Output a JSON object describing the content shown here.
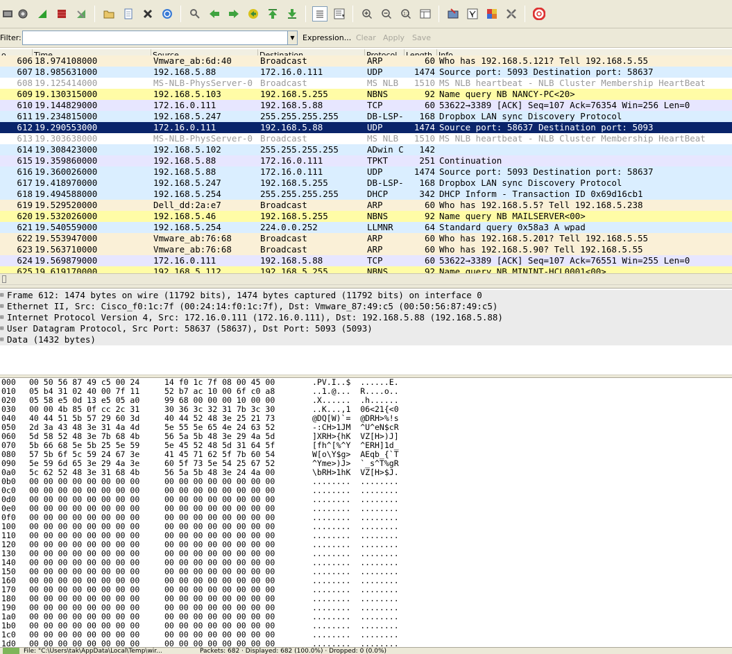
{
  "toolbar": {
    "icons": [
      "interface-list-icon",
      "capture-options-icon",
      "start-capture-icon",
      "stop-capture-icon",
      "restart-capture-icon",
      "open-file-icon",
      "save-file-icon",
      "close-file-icon",
      "reload-file-icon",
      "find-packet-icon",
      "go-back-icon",
      "go-forward-icon",
      "go-to-packet-icon",
      "go-first-icon",
      "go-last-icon",
      "colorize-icon",
      "auto-scroll-icon",
      "zoom-in-icon",
      "zoom-out-icon",
      "normal-size-icon",
      "resize-columns-icon",
      "capture-filters-icon",
      "display-filters-icon",
      "coloring-rules-icon",
      "preferences-icon",
      "help-icon"
    ]
  },
  "filter": {
    "label": "Filter:",
    "value": "",
    "expression": "Expression...",
    "clear": "Clear",
    "apply": "Apply",
    "save": "Save"
  },
  "packet_list": {
    "columns": [
      "o.",
      "Time",
      "Source",
      "Destination",
      "Protocol",
      "Length",
      "Info"
    ],
    "rows": [
      {
        "no": "606",
        "time": "18.974108000",
        "src": "Vmware_ab:6d:40",
        "dst": "Broadcast",
        "proto": "ARP",
        "len": "60",
        "info": "Who has 192.168.5.121?  Tell 192.168.5.55",
        "style": "arp"
      },
      {
        "no": "607",
        "time": "18.985631000",
        "src": "192.168.5.88",
        "dst": "172.16.0.111",
        "proto": "UDP",
        "len": "1474",
        "info": "Source port: 5093  Destination port: 58637",
        "style": "udp"
      },
      {
        "no": "608",
        "time": "19.125414000",
        "src": "MS-NLB-PhysServer-0",
        "dst": "Broadcast",
        "proto": "MS NLB",
        "len": "1510",
        "info": "MS NLB heartbeat - NLB Cluster Membership HeartBeat",
        "style": "nlb"
      },
      {
        "no": "609",
        "time": "19.130315000",
        "src": "192.168.5.103",
        "dst": "192.168.5.255",
        "proto": "NBNS",
        "len": "92",
        "info": "Name query NB NANCY-PC<20>",
        "style": "nbns"
      },
      {
        "no": "610",
        "time": "19.144829000",
        "src": "172.16.0.111",
        "dst": "192.168.5.88",
        "proto": "TCP",
        "len": "60",
        "info": "53622→3389 [ACK] Seq=107 Ack=76354 Win=256 Len=0",
        "style": "tcp"
      },
      {
        "no": "611",
        "time": "19.234815000",
        "src": "192.168.5.247",
        "dst": "255.255.255.255",
        "proto": "DB-LSP-",
        "len": "168",
        "info": "Dropbox LAN sync Discovery Protocol",
        "style": "udp"
      },
      {
        "no": "612",
        "time": "19.290553000",
        "src": "172.16.0.111",
        "dst": "192.168.5.88",
        "proto": "UDP",
        "len": "1474",
        "info": "Source port: 58637  Destination port: 5093",
        "style": "selected"
      },
      {
        "no": "613",
        "time": "19.303638000",
        "src": "MS-NLB-PhysServer-0",
        "dst": "Broadcast",
        "proto": "MS NLB",
        "len": "1510",
        "info": "MS NLB heartbeat - NLB Cluster Membership HeartBeat",
        "style": "nlb"
      },
      {
        "no": "614",
        "time": "19.308423000",
        "src": "192.168.5.102",
        "dst": "255.255.255.255",
        "proto": "ADwin C",
        "len": "142",
        "info": "",
        "style": "udp"
      },
      {
        "no": "615",
        "time": "19.359860000",
        "src": "192.168.5.88",
        "dst": "172.16.0.111",
        "proto": "TPKT",
        "len": "251",
        "info": "Continuation",
        "style": "tcp"
      },
      {
        "no": "616",
        "time": "19.360026000",
        "src": "192.168.5.88",
        "dst": "172.16.0.111",
        "proto": "UDP",
        "len": "1474",
        "info": "Source port: 5093  Destination port: 58637",
        "style": "udp"
      },
      {
        "no": "617",
        "time": "19.418970000",
        "src": "192.168.5.247",
        "dst": "192.168.5.255",
        "proto": "DB-LSP-",
        "len": "168",
        "info": "Dropbox LAN sync Discovery Protocol",
        "style": "udp"
      },
      {
        "no": "618",
        "time": "19.494588000",
        "src": "192.168.5.254",
        "dst": "255.255.255.255",
        "proto": "DHCP",
        "len": "342",
        "info": "DHCP Inform   - Transaction ID 0x69d16cb1",
        "style": "udp"
      },
      {
        "no": "619",
        "time": "19.529520000",
        "src": "Dell_dd:2a:e7",
        "dst": "Broadcast",
        "proto": "ARP",
        "len": "60",
        "info": "Who has 192.168.5.5?  Tell 192.168.5.238",
        "style": "arp"
      },
      {
        "no": "620",
        "time": "19.532026000",
        "src": "192.168.5.46",
        "dst": "192.168.5.255",
        "proto": "NBNS",
        "len": "92",
        "info": "Name query NB MAILSERVER<00>",
        "style": "nbns"
      },
      {
        "no": "621",
        "time": "19.540559000",
        "src": "192.168.5.254",
        "dst": "224.0.0.252",
        "proto": "LLMNR",
        "len": "64",
        "info": "Standard query 0x58a3  A wpad",
        "style": "udp"
      },
      {
        "no": "622",
        "time": "19.553947000",
        "src": "Vmware_ab:76:68",
        "dst": "Broadcast",
        "proto": "ARP",
        "len": "60",
        "info": "Who has 192.168.5.201?  Tell 192.168.5.55",
        "style": "arp"
      },
      {
        "no": "623",
        "time": "19.563710000",
        "src": "Vmware_ab:76:68",
        "dst": "Broadcast",
        "proto": "ARP",
        "len": "60",
        "info": "Who has 192.168.5.90?  Tell 192.168.5.55",
        "style": "arp"
      },
      {
        "no": "624",
        "time": "19.569879000",
        "src": "172.16.0.111",
        "dst": "192.168.5.88",
        "proto": "TCP",
        "len": "60",
        "info": "53622→3389 [ACK] Seq=107 Ack=76551 Win=255 Len=0",
        "style": "tcp"
      },
      {
        "no": "625",
        "time": "19.619170000",
        "src": "192.168.5.112",
        "dst": "192.168.5.255",
        "proto": "NBNS",
        "len": "92",
        "info": "Name query NB MININT-HCL0001<00>",
        "style": "nbns"
      }
    ]
  },
  "details": [
    "Frame 612: 1474 bytes on wire (11792 bits), 1474 bytes captured (11792 bits) on interface 0",
    "Ethernet II, Src: Cisco_f0:1c:7f (00:24:14:f0:1c:7f), Dst: Vmware_87:49:c5 (00:50:56:87:49:c5)",
    "Internet Protocol Version 4, Src: 172.16.0.111 (172.16.0.111), Dst: 192.168.5.88 (192.168.5.88)",
    "User Datagram Protocol, Src Port: 58637 (58637), Dst Port: 5093 (5093)",
    "Data (1432 bytes)"
  ],
  "bytes": [
    {
      "off": "000",
      "hex1": "00 50 56 87 49 c5 00 24",
      "hex2": "14 f0 1c 7f 08 00 45 00",
      "ascii": ".PV.I..$  ......E."
    },
    {
      "off": "010",
      "hex1": "05 b4 31 02 40 00 7f 11",
      "hex2": "52 b7 ac 10 00 6f c0 a8",
      "ascii": "..1.@...  R....o.."
    },
    {
      "off": "020",
      "hex1": "05 58 e5 0d 13 e5 05 a0",
      "hex2": "99 68 00 00 00 10 00 00",
      "ascii": ".X......  .h......"
    },
    {
      "off": "030",
      "hex1": "00 00 4b 85 0f cc 2c 31",
      "hex2": "30 36 3c 32 31 7b 3c 30",
      "ascii": "..K...,1  06<21{<0"
    },
    {
      "off": "040",
      "hex1": "40 44 51 5b 57 29 60 3d",
      "hex2": "40 44 52 48 3e 25 21 73",
      "ascii": "@DQ[W)`=  @DRH>%!s"
    },
    {
      "off": "050",
      "hex1": "2d 3a 43 48 3e 31 4a 4d",
      "hex2": "5e 55 5e 65 4e 24 63 52",
      "ascii": "-:CH>1JM  ^U^eN$cR"
    },
    {
      "off": "060",
      "hex1": "5d 58 52 48 3e 7b 68 4b",
      "hex2": "56 5a 5b 48 3e 29 4a 5d",
      "ascii": "]XRH>{hK  VZ[H>)J]"
    },
    {
      "off": "070",
      "hex1": "5b 66 68 5e 5b 25 5e 59",
      "hex2": "5e 45 52 48 5d 31 64 5f",
      "ascii": "[fh^[%^Y  ^ERH]1d_"
    },
    {
      "off": "080",
      "hex1": "57 5b 6f 5c 59 24 67 3e",
      "hex2": "41 45 71 62 5f 7b 60 54",
      "ascii": "W[o\\Y$g>  AEqb_{`T"
    },
    {
      "off": "090",
      "hex1": "5e 59 6d 65 3e 29 4a 3e",
      "hex2": "60 5f 73 5e 54 25 67 52",
      "ascii": "^Yme>)J>  `_s^T%gR"
    },
    {
      "off": "0a0",
      "hex1": "5c 62 52 48 3e 31 68 4b",
      "hex2": "56 5a 5b 48 3e 24 4a 00",
      "ascii": "\\bRH>1hK  VZ[H>$J."
    },
    {
      "off": "0b0",
      "hex1": "00 00 00 00 00 00 00 00",
      "hex2": "00 00 00 00 00 00 00 00",
      "ascii": "........  ........"
    },
    {
      "off": "0c0",
      "hex1": "00 00 00 00 00 00 00 00",
      "hex2": "00 00 00 00 00 00 00 00",
      "ascii": "........  ........"
    },
    {
      "off": "0d0",
      "hex1": "00 00 00 00 00 00 00 00",
      "hex2": "00 00 00 00 00 00 00 00",
      "ascii": "........  ........"
    },
    {
      "off": "0e0",
      "hex1": "00 00 00 00 00 00 00 00",
      "hex2": "00 00 00 00 00 00 00 00",
      "ascii": "........  ........"
    },
    {
      "off": "0f0",
      "hex1": "00 00 00 00 00 00 00 00",
      "hex2": "00 00 00 00 00 00 00 00",
      "ascii": "........  ........"
    },
    {
      "off": "100",
      "hex1": "00 00 00 00 00 00 00 00",
      "hex2": "00 00 00 00 00 00 00 00",
      "ascii": "........  ........"
    },
    {
      "off": "110",
      "hex1": "00 00 00 00 00 00 00 00",
      "hex2": "00 00 00 00 00 00 00 00",
      "ascii": "........  ........"
    },
    {
      "off": "120",
      "hex1": "00 00 00 00 00 00 00 00",
      "hex2": "00 00 00 00 00 00 00 00",
      "ascii": "........  ........"
    },
    {
      "off": "130",
      "hex1": "00 00 00 00 00 00 00 00",
      "hex2": "00 00 00 00 00 00 00 00",
      "ascii": "........  ........"
    },
    {
      "off": "140",
      "hex1": "00 00 00 00 00 00 00 00",
      "hex2": "00 00 00 00 00 00 00 00",
      "ascii": "........  ........"
    },
    {
      "off": "150",
      "hex1": "00 00 00 00 00 00 00 00",
      "hex2": "00 00 00 00 00 00 00 00",
      "ascii": "........  ........"
    },
    {
      "off": "160",
      "hex1": "00 00 00 00 00 00 00 00",
      "hex2": "00 00 00 00 00 00 00 00",
      "ascii": "........  ........"
    },
    {
      "off": "170",
      "hex1": "00 00 00 00 00 00 00 00",
      "hex2": "00 00 00 00 00 00 00 00",
      "ascii": "........  ........"
    },
    {
      "off": "180",
      "hex1": "00 00 00 00 00 00 00 00",
      "hex2": "00 00 00 00 00 00 00 00",
      "ascii": "........  ........"
    },
    {
      "off": "190",
      "hex1": "00 00 00 00 00 00 00 00",
      "hex2": "00 00 00 00 00 00 00 00",
      "ascii": "........  ........"
    },
    {
      "off": "1a0",
      "hex1": "00 00 00 00 00 00 00 00",
      "hex2": "00 00 00 00 00 00 00 00",
      "ascii": "........  ........"
    },
    {
      "off": "1b0",
      "hex1": "00 00 00 00 00 00 00 00",
      "hex2": "00 00 00 00 00 00 00 00",
      "ascii": "........  ........"
    },
    {
      "off": "1c0",
      "hex1": "00 00 00 00 00 00 00 00",
      "hex2": "00 00 00 00 00 00 00 00",
      "ascii": "........  ........"
    },
    {
      "off": "1d0",
      "hex1": "00 00 00 00 00 00 00 00",
      "hex2": "00 00 00 00 00 00 00 00",
      "ascii": "........  ........"
    }
  ],
  "statusbar": {
    "file": "File: \"C:\\Users\\tak\\AppData\\Local\\Temp\\wir...",
    "packets": "Packets: 682 · Displayed: 682 (100.0%) · Dropped: 0 (0.0%)"
  },
  "colors": {
    "udp": "#daeeff",
    "tcp": "#e7e6ff",
    "arp": "#faf0d7",
    "nbns": "#fffca6",
    "nlb": "#ffffff",
    "selected": "#0a246a",
    "nlb_text": "#9a9a9a"
  }
}
